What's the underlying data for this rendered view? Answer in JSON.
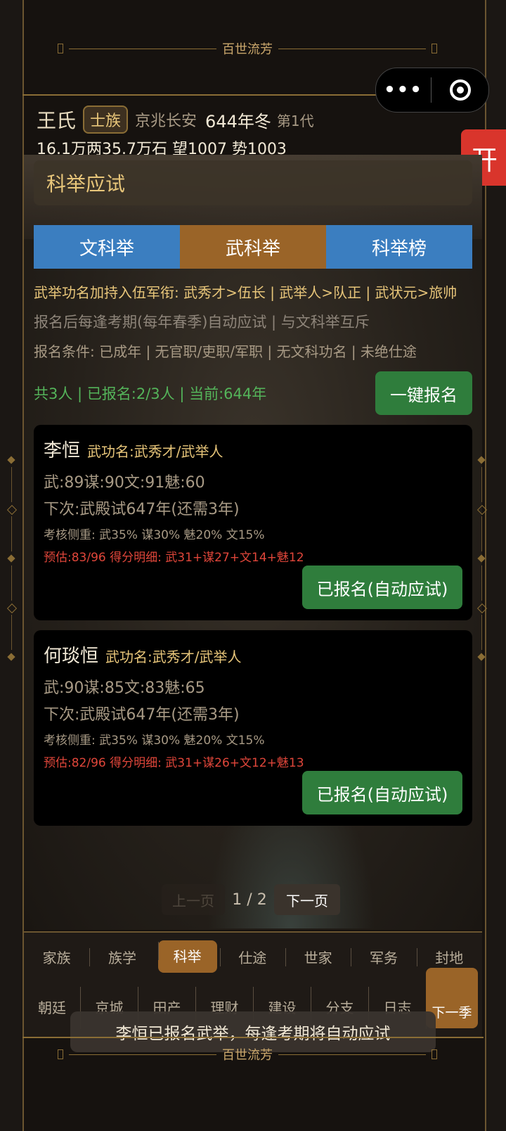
{
  "banner": {
    "title": "百世流芳"
  },
  "capsule": {
    "more": "•••"
  },
  "side_button": {
    "label": "开"
  },
  "header": {
    "family_name": "王氏",
    "rank": "士族",
    "location": "京兆长安",
    "year": "644年冬",
    "generation": "第1代",
    "resources": "16.1万两35.7万石  望1007 势1003"
  },
  "section": {
    "title": "科举应试"
  },
  "tabs": [
    {
      "label": "文科举"
    },
    {
      "label": "武科举"
    },
    {
      "label": "科举榜"
    }
  ],
  "info": {
    "line1": "武举功名加持入伍军衔: 武秀才>伍长 | 武举人>队正 | 武状元>旅帅",
    "line2": "报名后每逢考期(每年春季)自动应试 | 与文科举互斥",
    "line3": "报名条件: 已成年 | 无官职/吏职/军职 | 无文科功名 | 未绝仕途",
    "count": "共3人 | 已报名:2/3人 | 当前:644年",
    "signup_all": "一键报名"
  },
  "candidates": [
    {
      "name": "李恒",
      "title": "武功名:武秀才/武举人",
      "stats": "武:89谋:90文:91魅:60",
      "next": "下次:武殿试647年(还需3年)",
      "weights": "考核侧重: 武35% 谋30% 魅20% 文15%",
      "estimate": "预估:83/96  得分明细: 武31+谋27+文14+魅12",
      "status": "已报名(自动应试)"
    },
    {
      "name": "何琰恒",
      "title": "武功名:武秀才/武举人",
      "stats": "武:90谋:85文:83魅:65",
      "next": "下次:武殿试647年(还需3年)",
      "weights": "考核侧重: 武35% 谋30% 魅20% 文15%",
      "estimate": "预估:82/96  得分明细: 武31+谋26+文12+魅13",
      "status": "已报名(自动应试)"
    }
  ],
  "pager": {
    "prev": "上一页",
    "current": "1 / 2",
    "next": "下一页"
  },
  "nav_primary": [
    {
      "label": "家族"
    },
    {
      "label": "族学"
    },
    {
      "label": "科举"
    },
    {
      "label": "仕途"
    },
    {
      "label": "世家"
    },
    {
      "label": "军务"
    },
    {
      "label": "封地"
    }
  ],
  "nav_secondary": [
    {
      "label": "朝廷"
    },
    {
      "label": "京城"
    },
    {
      "label": "田产"
    },
    {
      "label": "理财"
    },
    {
      "label": "建设"
    },
    {
      "label": "分支"
    },
    {
      "label": "日志"
    }
  ],
  "next_season": "下一季",
  "toast": "李恒已报名武举，每逢考期将自动应试"
}
